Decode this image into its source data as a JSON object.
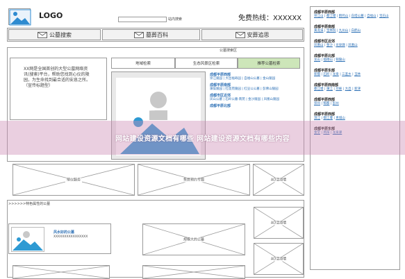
{
  "header": {
    "logo_label": "LOGO",
    "search_label": "站内搜索",
    "hotline": "免费热线：XXXXXX"
  },
  "nav": {
    "items": [
      {
        "label": "公墓搜索"
      },
      {
        "label": "墓葬百科"
      },
      {
        "label": "安葬追思"
      }
    ]
  },
  "search_panel": {
    "title": "公墓搜索区",
    "tabs": [
      "地域检索",
      "生态风景区检索",
      "推荐公墓检索"
    ],
    "intro": "XX网是全国首创的大型公墓网络资讯(搜索)平台，帮助您找到心仪的陵园，为生命找到最合适的安息之所。（宣传标题型）",
    "map_label": "地图检索",
    "regions": [
      {
        "name": "成都平原西部",
        "links": "崇江陵园 | 大邑福寿园 | 自福山公墓 | 金山陵园"
      },
      {
        "name": "成都平原南部",
        "links": "蒲侯陵园 | 红莲苑陵园 | 红豆公公墓 | 彭佛山陵园"
      },
      {
        "name": "成都市区近郊",
        "links": "凤山公墓 | 石岭公墓·南苑 | 金沙陵园 | 凤凰山陵园"
      },
      {
        "name": "成都平原北部",
        "links": ""
      }
    ]
  },
  "sidebar": {
    "groups": [
      {
        "name": "成都平原西部",
        "links": [
          "崇江山",
          "都江堰",
          "鹤鸣山",
          "白塔公墓",
          "自福山",
          "宝石山"
        ]
      },
      {
        "name": "成都平原南部",
        "links": [
          "黄龙溪",
          "宝林院",
          "九州山",
          "白鹤山"
        ]
      },
      {
        "name": "成都市区近郊",
        "links": [
          "凤凰山",
          "金沙",
          "龙泉驿",
          "凤凰山"
        ]
      },
      {
        "name": "成都平原北部",
        "links": [
          "龙山",
          "福德山",
          "铜陵山"
        ]
      },
      {
        "name": "成都平原东部",
        "links": [
          "新都",
          "石岭",
          "龙泉",
          "三圣乡",
          "玉林"
        ]
      },
      {
        "name": "成都平原西南部",
        "links": [
          "都江堰",
          "蒲江",
          "邛崃",
          "大邑",
          "新津"
        ]
      },
      {
        "name": "成都平原西部",
        "links": [
          "崇州",
          "郫都",
          "彭州"
        ]
      },
      {
        "name": "成都平原西部",
        "links": [
          "温江",
          "都江堰",
          "青城山"
        ]
      },
      {
        "name": "成都平原东部",
        "links": [
          "金堂",
          "简阳",
          "龙泉驿"
        ]
      }
    ]
  },
  "mid_placeholders": [
    "殡仪服务",
    "免费预约专题",
    "AD活动墙"
  ],
  "featured": {
    "title": ">>>>>>特色属性的公墓",
    "item_name": "风水好的公墓",
    "item_sub": "XXXXXXXXXXXXXXXX"
  },
  "bottom_placeholders": [
    "AD活动墙",
    "规模大的公墓",
    "AD活动墙"
  ],
  "overlay": {
    "text": "网站建设资源文档有哪些 网站建设资源文档有哪些内容"
  }
}
